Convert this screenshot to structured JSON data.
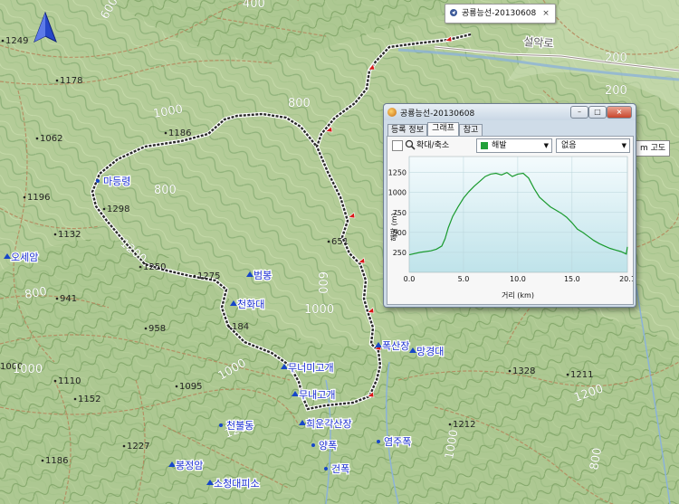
{
  "map": {
    "elevation_labels": [
      "1249",
      "1178",
      "1062",
      "1196",
      "1132",
      "941",
      "1110",
      "1152",
      "1186",
      "1227",
      "1095",
      "958",
      "184",
      "1250",
      "1298",
      "1186",
      "1275",
      "651",
      "1328",
      "1211",
      "1212",
      "1000"
    ],
    "contour_labels": [
      "600",
      "400",
      "1000",
      "800",
      "1200",
      "800",
      "600",
      "1000",
      "1000",
      "1200",
      "1000",
      "1200",
      "1000",
      "800",
      "1000",
      "200",
      "200",
      "1200",
      "800"
    ],
    "road_label": "설악로",
    "places": [
      "마등령",
      "오세암",
      "봉정암",
      "소청대피소",
      "천화대",
      "범봉",
      "무너미고개",
      "무내고개",
      "희운각산장",
      "폭산장",
      "망경대",
      "양폭",
      "천불동",
      "염주폭",
      "건폭"
    ],
    "track_color": "#2a2a2a",
    "accent_red": "#d81818",
    "place_color": "#1a2fd0"
  },
  "track_tooltip": {
    "title": "공룡능선-20130608",
    "close": "×"
  },
  "altitude_tooltip": {
    "text": "m 고도"
  },
  "window": {
    "title": "공룡능선-20130608",
    "controls": {
      "minimize": "–",
      "maximize": "□",
      "close": "×"
    },
    "tabs": [
      {
        "label": "등록 정보",
        "active": false
      },
      {
        "label": "그래프",
        "active": true
      },
      {
        "label": "참고",
        "active": false
      }
    ],
    "toolbar": {
      "zoom_label": "확대/축소",
      "series_select": "해발",
      "secondary_select": "없음"
    }
  },
  "chart_data": {
    "type": "line",
    "xlabel": "거리 (km)",
    "ylabel": "해발 (m)",
    "xlim": [
      0,
      20.1
    ],
    "ylim": [
      0,
      1450
    ],
    "xticks": [
      "0.0",
      "5.0",
      "10.0",
      "15.0",
      "20.1"
    ],
    "xtick_values": [
      0,
      5,
      10,
      15,
      20.1
    ],
    "yticks": [
      "250",
      "500",
      "750",
      "1000",
      "1250"
    ],
    "ytick_values": [
      250,
      500,
      750,
      1000,
      1250
    ],
    "grid": true,
    "series": [
      {
        "color": "#1a9a2e",
        "x": [
          0,
          1,
          2,
          2.5,
          3,
          3.3,
          3.6,
          4,
          4.5,
          5,
          5.5,
          6,
          6.5,
          7,
          7.5,
          8,
          8.5,
          9,
          9.5,
          10,
          10.5,
          11,
          11.5,
          12,
          12.5,
          13,
          13.5,
          14,
          14.5,
          15,
          15.5,
          16,
          16.5,
          17,
          17.5,
          18,
          18.5,
          19,
          19.5,
          20,
          20.1
        ],
        "y": [
          220,
          250,
          270,
          290,
          330,
          420,
          560,
          700,
          820,
          930,
          1010,
          1080,
          1140,
          1200,
          1230,
          1240,
          1220,
          1250,
          1200,
          1230,
          1240,
          1180,
          1050,
          940,
          880,
          820,
          780,
          740,
          690,
          620,
          540,
          500,
          450,
          400,
          360,
          330,
          300,
          280,
          260,
          230,
          320
        ]
      }
    ]
  }
}
